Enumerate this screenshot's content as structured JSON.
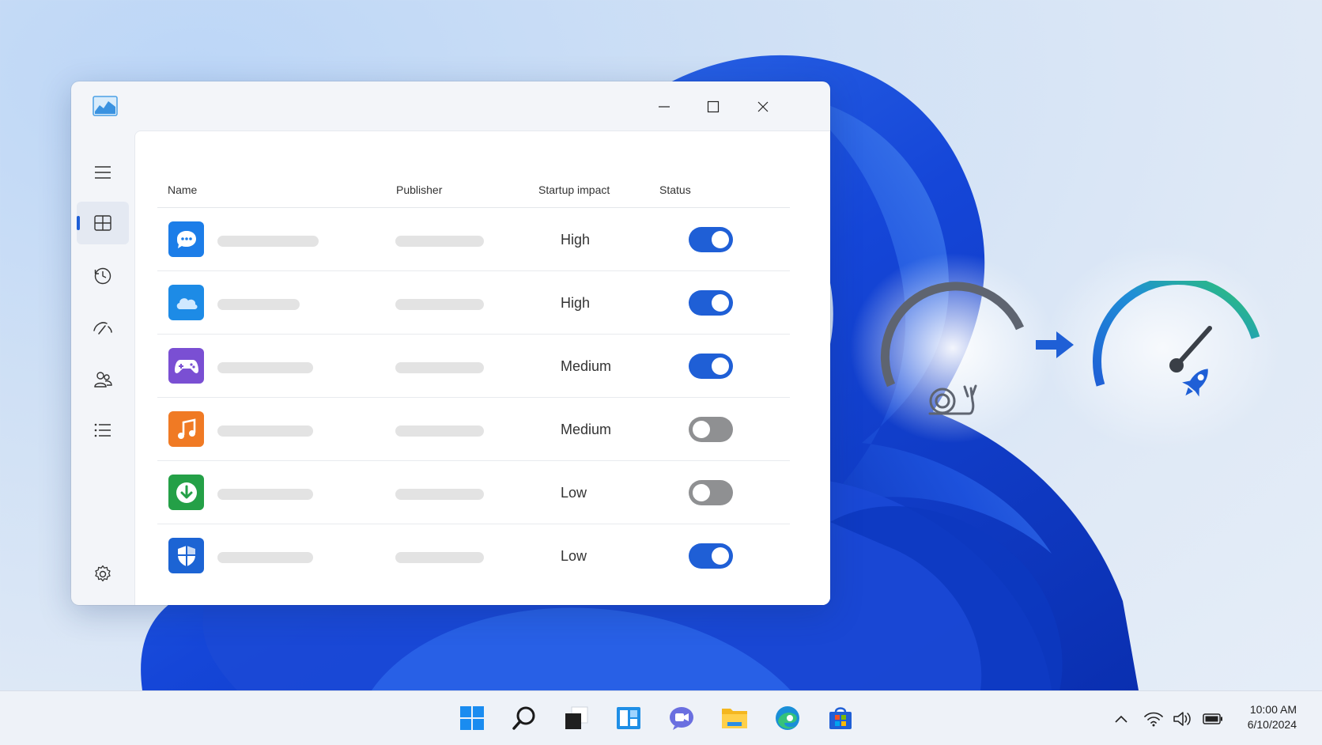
{
  "window": {
    "title_icon": "monitor-chart-icon",
    "controls": [
      "minimize-icon",
      "maximize-icon",
      "close-icon"
    ]
  },
  "nav": {
    "items": [
      "menu-icon",
      "apps-icon",
      "history-icon",
      "performance-icon",
      "users-icon",
      "details-icon"
    ],
    "active": "apps-icon",
    "footer": "settings-icon"
  },
  "table": {
    "headers": {
      "name": "Name",
      "publisher": "Publisher",
      "impact": "Startup impact",
      "status": "Status"
    },
    "rows": [
      {
        "icon": "chat-icon",
        "color": "#1c7de8",
        "impact": "High",
        "enabled": true
      },
      {
        "icon": "cloud-icon",
        "color": "#1d8be6",
        "impact": "High",
        "enabled": true
      },
      {
        "icon": "game-controller-icon",
        "color": "#7a4fd3",
        "impact": "Medium",
        "enabled": true
      },
      {
        "icon": "music-note-icon",
        "color": "#f07a24",
        "impact": "Medium",
        "enabled": false
      },
      {
        "icon": "download-icon",
        "color": "#24a047",
        "impact": "Low",
        "enabled": false
      },
      {
        "icon": "shield-icon",
        "color": "#1c64d4",
        "impact": "Low",
        "enabled": true
      }
    ]
  },
  "illustration": {
    "icons": [
      "snail-icon",
      "arrow-right-icon",
      "speedometer-icon",
      "rocket-icon"
    ],
    "colors": {
      "slow": "#5e6470",
      "fast_start": "#1f5fd6",
      "fast_end": "#2ec86a"
    }
  },
  "taskbar": {
    "apps": [
      "windows-start-icon",
      "search-icon",
      "task-view-icon",
      "widgets-icon",
      "teams-chat-icon",
      "file-explorer-icon",
      "edge-icon",
      "store-icon"
    ],
    "tray": [
      "chevron-up-icon",
      "wifi-icon",
      "volume-icon",
      "battery-icon"
    ],
    "time": "10:00 AM",
    "date": "6/10/2024"
  },
  "colors": {
    "accent": "#1f5fd6",
    "toggle_off": "#8f9092"
  }
}
